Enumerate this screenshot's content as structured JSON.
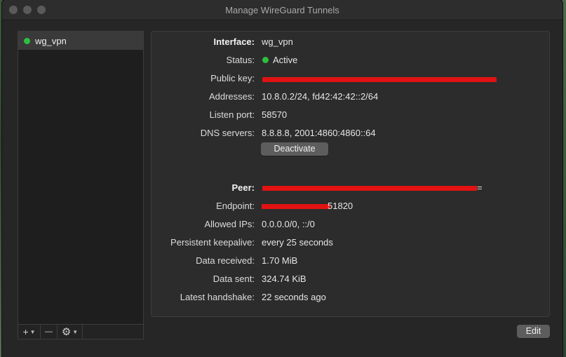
{
  "window": {
    "title": "Manage WireGuard Tunnels"
  },
  "sidebar": {
    "tunnels": [
      {
        "name": "wg_vpn",
        "status_color": "#2fbf3f"
      }
    ],
    "toolbar": {
      "add_label": "+",
      "remove_label": "—",
      "gear_label": "⚙"
    }
  },
  "interface": {
    "interface_label": "Interface:",
    "interface_value": "wg_vpn",
    "status_label": "Status:",
    "status_value": "Active",
    "public_key_label": "Public key:",
    "public_key_value": "",
    "addresses_label": "Addresses:",
    "addresses_value": "10.8.0.2/24, fd42:42:42::2/64",
    "listen_port_label": "Listen port:",
    "listen_port_value": "58570",
    "dns_label": "DNS servers:",
    "dns_value": "8.8.8.8, 2001:4860:4860::64",
    "deactivate_label": "Deactivate"
  },
  "peer": {
    "peer_label": "Peer:",
    "peer_value_suffix": "=",
    "endpoint_label": "Endpoint:",
    "endpoint_value_suffix": "51820",
    "allowed_ips_label": "Allowed IPs:",
    "allowed_ips_value": "0.0.0.0/0, ::/0",
    "keepalive_label": "Persistent keepalive:",
    "keepalive_value": "every 25 seconds",
    "received_label": "Data received:",
    "received_value": "1.70 MiB",
    "sent_label": "Data sent:",
    "sent_value": "324.74 KiB",
    "handshake_label": "Latest handshake:",
    "handshake_value": "22 seconds ago"
  },
  "footer": {
    "edit_label": "Edit"
  },
  "colors": {
    "active_dot": "#2fbf3f",
    "redaction": "#e31212"
  }
}
